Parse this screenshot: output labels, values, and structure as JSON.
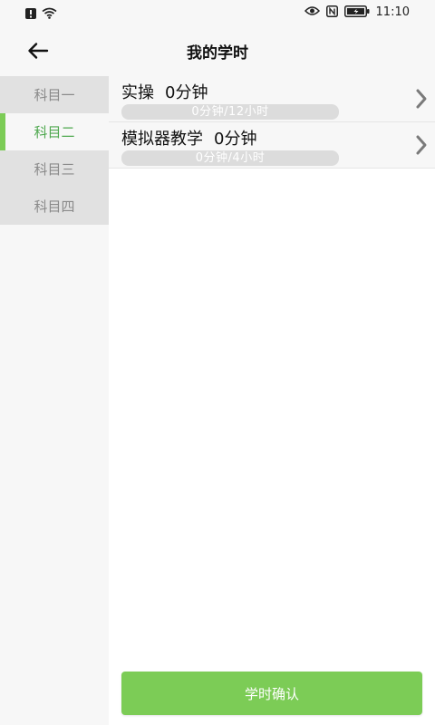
{
  "status_bar": {
    "time": "11:10",
    "icons": [
      "alert-icon",
      "wifi-icon",
      "eye-icon",
      "nfc-icon",
      "battery-icon"
    ]
  },
  "header": {
    "title": "我的学时",
    "back_icon": "arrow-left-icon"
  },
  "sidebar": {
    "items": [
      {
        "label": "科目一",
        "active": false
      },
      {
        "label": "科目二",
        "active": true
      },
      {
        "label": "科目三",
        "active": false
      },
      {
        "label": "科目四",
        "active": false
      }
    ]
  },
  "courses": [
    {
      "name": "实操",
      "duration": "0分钟",
      "progress_text": "0分钟/12小时",
      "progress_fraction": 0
    },
    {
      "name": "模拟器教学",
      "duration": "0分钟",
      "progress_text": "0分钟/4小时",
      "progress_fraction": 0
    }
  ],
  "confirm_button": {
    "label": "学时确认"
  },
  "colors": {
    "accent": "#7ccc56",
    "active_text": "#4fa84f",
    "inactive_text": "#8a8a8a",
    "sidebar_inactive_bg": "#e1e1e1",
    "panel_bg": "#f7f7f7",
    "progress_track": "#dcdcdc"
  }
}
